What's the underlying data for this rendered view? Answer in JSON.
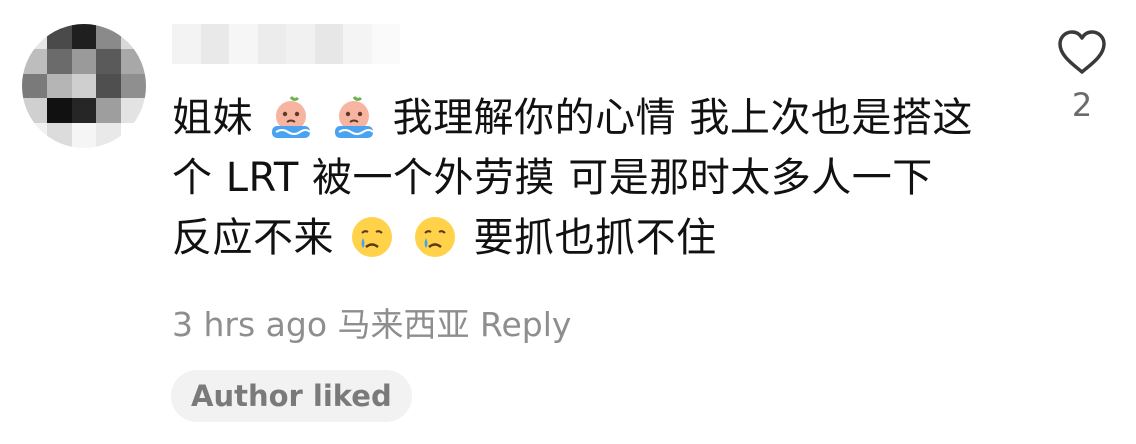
{
  "comment": {
    "lines": [
      [
        "姐妹",
        "我理解你的心情 我上次也是搭这"
      ],
      [
        "个 LRT 被一个外劳摸 可是那时太多人一下"
      ],
      [
        "反应不来",
        "要抓也抓不住"
      ]
    ],
    "emojis": [
      "crying-peach-emoji",
      "crying-peach-emoji",
      "crying-face-emoji",
      "crying-face-emoji"
    ]
  },
  "meta": {
    "time": "3 hrs ago",
    "location": "马来西亚",
    "reply_label": "Reply"
  },
  "badge": {
    "author_liked": "Author liked"
  },
  "like": {
    "count": "2",
    "icon": "heart-outline-icon"
  },
  "colors": {
    "meta_text": "#8e8e8e",
    "badge_bg": "#f2f2f2",
    "badge_text": "#7a7a7a",
    "emoji_face": "#ffd24a",
    "tear": "#4aa3f0",
    "peach": "#f7b4a0"
  }
}
